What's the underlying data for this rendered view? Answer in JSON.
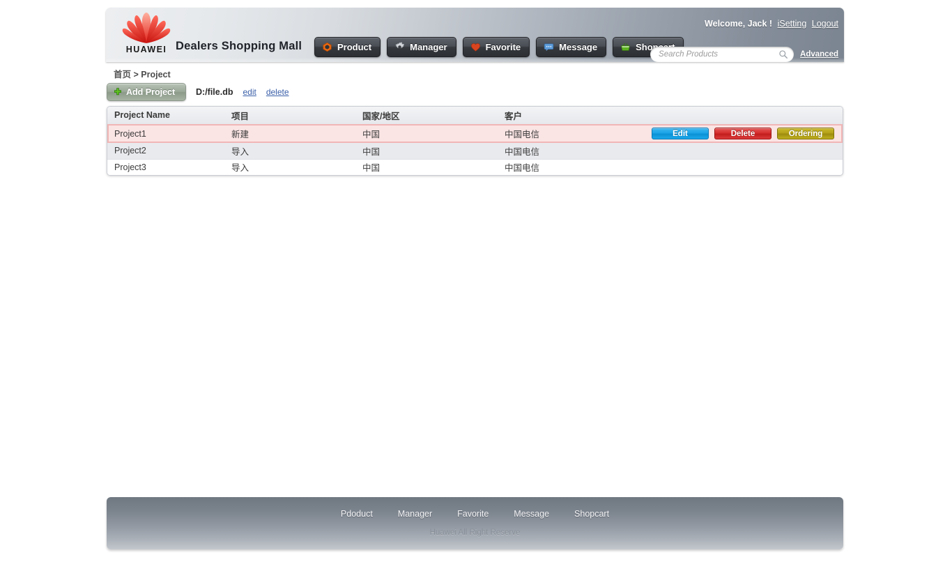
{
  "header": {
    "logo_word": "HUAWEI",
    "brand": "Dealers Shopping Mall",
    "nav": [
      {
        "label": "Product",
        "icon": "hexagon-icon"
      },
      {
        "label": "Manager",
        "icon": "gear-icon"
      },
      {
        "label": "Favorite",
        "icon": "heart-icon"
      },
      {
        "label": "Message",
        "icon": "speech-bubble-icon"
      },
      {
        "label": "Shopcart",
        "icon": "basket-icon"
      }
    ],
    "welcome_text": "Welcome,  Jack !",
    "isetting_label": "iSetting",
    "logout_label": "Logout",
    "search_placeholder": "Search Products",
    "search_value": "",
    "search_icon": "search-icon",
    "advanced_label": "Advanced"
  },
  "breadcrumb": {
    "home": "首页",
    "sep": ">",
    "current": "Project"
  },
  "toolbar": {
    "add_label": "Add Project",
    "add_icon": "plus-icon",
    "db_path": "D:/file.db",
    "edit_link": "edit",
    "delete_link": "delete"
  },
  "table": {
    "columns": [
      "Project Name",
      "项目",
      "国家/地区",
      "客户",
      ""
    ],
    "rows": [
      {
        "name": "Project1",
        "type": "新建",
        "region": "中国",
        "customer": "中国电信",
        "selected": true,
        "actions": [
          "Edit",
          "Delete",
          "Ordering"
        ]
      },
      {
        "name": "Project2",
        "type": "导入",
        "region": "中国",
        "customer": "中国电信",
        "selected": false,
        "actions": []
      },
      {
        "name": "Project3",
        "type": "导入",
        "region": "中国",
        "customer": "中国电信",
        "selected": false,
        "actions": []
      }
    ]
  },
  "footer": {
    "links": [
      "Pdoduct",
      "Manager",
      "Favorite",
      "Message",
      "Shopcart"
    ],
    "copyright": "Huawei All Right Reserve"
  },
  "colors": {
    "edit": "#17a2e6",
    "delete": "#d42a2a",
    "ordering": "#b3a018",
    "huawei_red": "#e2231a",
    "selected_row": "#fbe4e4",
    "link": "#3a5fa8"
  }
}
